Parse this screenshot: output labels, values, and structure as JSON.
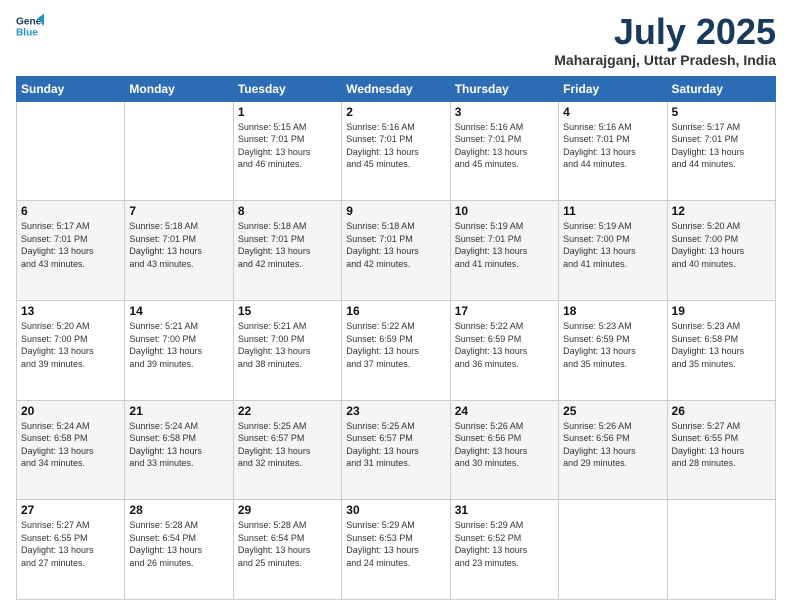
{
  "header": {
    "logo_line1": "General",
    "logo_line2": "Blue",
    "month_year": "July 2025",
    "location": "Maharajganj, Uttar Pradesh, India"
  },
  "weekdays": [
    "Sunday",
    "Monday",
    "Tuesday",
    "Wednesday",
    "Thursday",
    "Friday",
    "Saturday"
  ],
  "weeks": [
    [
      {
        "day": "",
        "info": ""
      },
      {
        "day": "",
        "info": ""
      },
      {
        "day": "1",
        "info": "Sunrise: 5:15 AM\nSunset: 7:01 PM\nDaylight: 13 hours\nand 46 minutes."
      },
      {
        "day": "2",
        "info": "Sunrise: 5:16 AM\nSunset: 7:01 PM\nDaylight: 13 hours\nand 45 minutes."
      },
      {
        "day": "3",
        "info": "Sunrise: 5:16 AM\nSunset: 7:01 PM\nDaylight: 13 hours\nand 45 minutes."
      },
      {
        "day": "4",
        "info": "Sunrise: 5:16 AM\nSunset: 7:01 PM\nDaylight: 13 hours\nand 44 minutes."
      },
      {
        "day": "5",
        "info": "Sunrise: 5:17 AM\nSunset: 7:01 PM\nDaylight: 13 hours\nand 44 minutes."
      }
    ],
    [
      {
        "day": "6",
        "info": "Sunrise: 5:17 AM\nSunset: 7:01 PM\nDaylight: 13 hours\nand 43 minutes."
      },
      {
        "day": "7",
        "info": "Sunrise: 5:18 AM\nSunset: 7:01 PM\nDaylight: 13 hours\nand 43 minutes."
      },
      {
        "day": "8",
        "info": "Sunrise: 5:18 AM\nSunset: 7:01 PM\nDaylight: 13 hours\nand 42 minutes."
      },
      {
        "day": "9",
        "info": "Sunrise: 5:18 AM\nSunset: 7:01 PM\nDaylight: 13 hours\nand 42 minutes."
      },
      {
        "day": "10",
        "info": "Sunrise: 5:19 AM\nSunset: 7:01 PM\nDaylight: 13 hours\nand 41 minutes."
      },
      {
        "day": "11",
        "info": "Sunrise: 5:19 AM\nSunset: 7:00 PM\nDaylight: 13 hours\nand 41 minutes."
      },
      {
        "day": "12",
        "info": "Sunrise: 5:20 AM\nSunset: 7:00 PM\nDaylight: 13 hours\nand 40 minutes."
      }
    ],
    [
      {
        "day": "13",
        "info": "Sunrise: 5:20 AM\nSunset: 7:00 PM\nDaylight: 13 hours\nand 39 minutes."
      },
      {
        "day": "14",
        "info": "Sunrise: 5:21 AM\nSunset: 7:00 PM\nDaylight: 13 hours\nand 39 minutes."
      },
      {
        "day": "15",
        "info": "Sunrise: 5:21 AM\nSunset: 7:00 PM\nDaylight: 13 hours\nand 38 minutes."
      },
      {
        "day": "16",
        "info": "Sunrise: 5:22 AM\nSunset: 6:59 PM\nDaylight: 13 hours\nand 37 minutes."
      },
      {
        "day": "17",
        "info": "Sunrise: 5:22 AM\nSunset: 6:59 PM\nDaylight: 13 hours\nand 36 minutes."
      },
      {
        "day": "18",
        "info": "Sunrise: 5:23 AM\nSunset: 6:59 PM\nDaylight: 13 hours\nand 35 minutes."
      },
      {
        "day": "19",
        "info": "Sunrise: 5:23 AM\nSunset: 6:58 PM\nDaylight: 13 hours\nand 35 minutes."
      }
    ],
    [
      {
        "day": "20",
        "info": "Sunrise: 5:24 AM\nSunset: 6:58 PM\nDaylight: 13 hours\nand 34 minutes."
      },
      {
        "day": "21",
        "info": "Sunrise: 5:24 AM\nSunset: 6:58 PM\nDaylight: 13 hours\nand 33 minutes."
      },
      {
        "day": "22",
        "info": "Sunrise: 5:25 AM\nSunset: 6:57 PM\nDaylight: 13 hours\nand 32 minutes."
      },
      {
        "day": "23",
        "info": "Sunrise: 5:25 AM\nSunset: 6:57 PM\nDaylight: 13 hours\nand 31 minutes."
      },
      {
        "day": "24",
        "info": "Sunrise: 5:26 AM\nSunset: 6:56 PM\nDaylight: 13 hours\nand 30 minutes."
      },
      {
        "day": "25",
        "info": "Sunrise: 5:26 AM\nSunset: 6:56 PM\nDaylight: 13 hours\nand 29 minutes."
      },
      {
        "day": "26",
        "info": "Sunrise: 5:27 AM\nSunset: 6:55 PM\nDaylight: 13 hours\nand 28 minutes."
      }
    ],
    [
      {
        "day": "27",
        "info": "Sunrise: 5:27 AM\nSunset: 6:55 PM\nDaylight: 13 hours\nand 27 minutes."
      },
      {
        "day": "28",
        "info": "Sunrise: 5:28 AM\nSunset: 6:54 PM\nDaylight: 13 hours\nand 26 minutes."
      },
      {
        "day": "29",
        "info": "Sunrise: 5:28 AM\nSunset: 6:54 PM\nDaylight: 13 hours\nand 25 minutes."
      },
      {
        "day": "30",
        "info": "Sunrise: 5:29 AM\nSunset: 6:53 PM\nDaylight: 13 hours\nand 24 minutes."
      },
      {
        "day": "31",
        "info": "Sunrise: 5:29 AM\nSunset: 6:52 PM\nDaylight: 13 hours\nand 23 minutes."
      },
      {
        "day": "",
        "info": ""
      },
      {
        "day": "",
        "info": ""
      }
    ]
  ]
}
